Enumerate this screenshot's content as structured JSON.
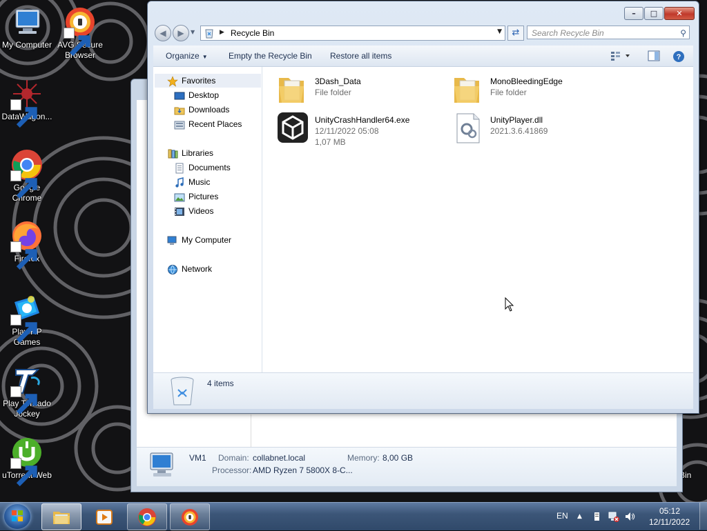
{
  "desktop": {
    "icons": [
      {
        "label": "My Computer"
      },
      {
        "label": "AVG Secure Browser"
      },
      {
        "label": "DataWagon..."
      },
      {
        "label": "Google Chrome"
      },
      {
        "label": "Firefox"
      },
      {
        "label": "Play HP Games"
      },
      {
        "label": "Play Tornado Jockey"
      },
      {
        "label": "uTorrent Web"
      }
    ],
    "partial_right_label": "Bin"
  },
  "background_window": {
    "computer_name": "VM1",
    "domain_label": "Domain:",
    "domain_value": "collabnet.local",
    "memory_label": "Memory:",
    "memory_value": "8,00 GB",
    "processor_label": "Processor:",
    "processor_value": "AMD Ryzen 7 5800X 8-C..."
  },
  "explorer": {
    "address": {
      "crumb": "Recycle Bin"
    },
    "search": {
      "placeholder": "Search Recycle Bin"
    },
    "toolbar": {
      "organize": "Organize",
      "empty": "Empty the Recycle Bin",
      "restore": "Restore all items"
    },
    "nav": {
      "favorites": "Favorites",
      "desktop": "Desktop",
      "downloads": "Downloads",
      "recent": "Recent Places",
      "libraries": "Libraries",
      "documents": "Documents",
      "music": "Music",
      "pictures": "Pictures",
      "videos": "Videos",
      "computer": "My Computer",
      "network": "Network"
    },
    "files": [
      {
        "name": "3Dash_Data",
        "meta1": "File folder",
        "meta2": ""
      },
      {
        "name": "MonoBleedingEdge",
        "meta1": "File folder",
        "meta2": ""
      },
      {
        "name": "UnityCrashHandler64.exe",
        "meta1": "12/11/2022 05:08",
        "meta2": "1,07 MB"
      },
      {
        "name": "UnityPlayer.dll",
        "meta1": "2021.3.6.41869",
        "meta2": ""
      }
    ],
    "status": {
      "count": "4 items"
    }
  },
  "taskbar": {
    "language": "EN",
    "time": "05:12",
    "date": "12/11/2022"
  }
}
